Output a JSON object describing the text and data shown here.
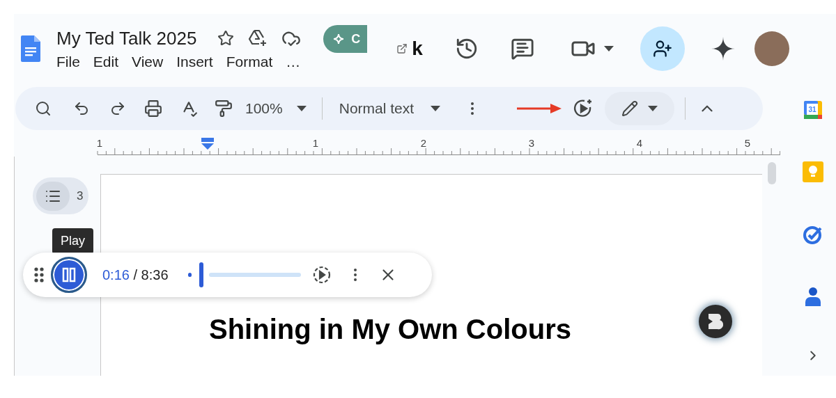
{
  "doc": {
    "title": "My Ted Talk 2025"
  },
  "menu": [
    "File",
    "Edit",
    "View",
    "Insert",
    "Format",
    "…"
  ],
  "badge": {
    "label": "C"
  },
  "extension": {
    "label": "k"
  },
  "toolbar": {
    "zoom": "100%",
    "style": "Normal text"
  },
  "ruler": {
    "labels": [
      "1",
      "1",
      "2",
      "3",
      "4",
      "5"
    ]
  },
  "outline": {
    "count": "3"
  },
  "tooltip": {
    "label": "Play"
  },
  "player": {
    "playing": true,
    "elapsed": "0:16",
    "total": "/ 8:36",
    "level": 0.1
  },
  "heading": "Shining in My Own Colours",
  "rail": {
    "calendar_day": "31"
  }
}
